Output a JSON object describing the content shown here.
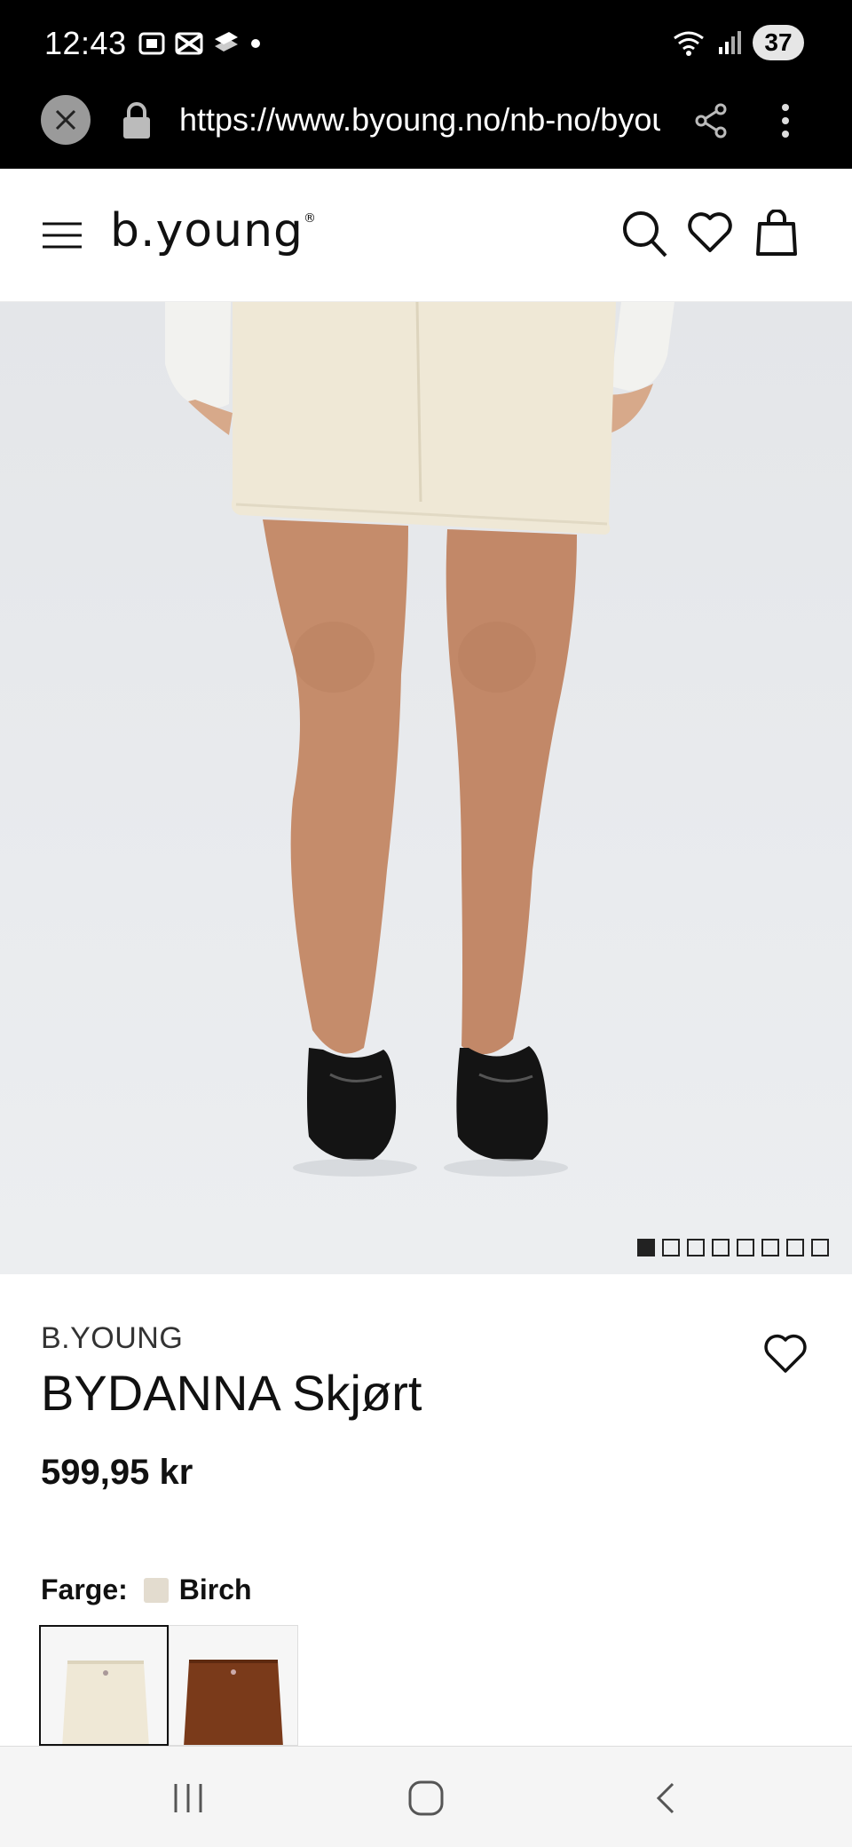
{
  "status_bar": {
    "time": "12:43",
    "battery": "37"
  },
  "browser": {
    "url": "https://www.byoung.no/nb-no/byoung/bydanna-skjort"
  },
  "header": {
    "logo": "b.young",
    "logo_mark": "®"
  },
  "gallery": {
    "image_count": 8,
    "active_index": 0
  },
  "product": {
    "brand": "B.YOUNG",
    "name": "BYDANNA Skjørt",
    "price": "599,95 kr",
    "color_label": "Farge:",
    "color_value": "Birch",
    "swatch_color": "#e3dccf"
  },
  "variants": [
    {
      "color": "Birch",
      "hex": "#efe8d6",
      "selected": true
    },
    {
      "color": "Brown",
      "hex": "#7a3a1a",
      "selected": false
    }
  ]
}
